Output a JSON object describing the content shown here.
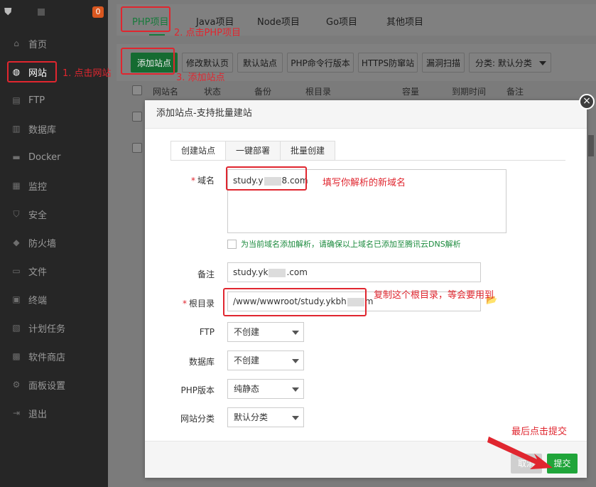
{
  "sidebar": {
    "badge": "0",
    "items": [
      {
        "label": "首页",
        "icon": "home-icon"
      },
      {
        "label": "网站",
        "icon": "globe-icon"
      },
      {
        "label": "FTP",
        "icon": "ftp-icon"
      },
      {
        "label": "数据库",
        "icon": "database-icon"
      },
      {
        "label": "Docker",
        "icon": "docker-icon"
      },
      {
        "label": "监控",
        "icon": "monitor-icon"
      },
      {
        "label": "安全",
        "icon": "shield-icon"
      },
      {
        "label": "防火墙",
        "icon": "firewall-icon"
      },
      {
        "label": "文件",
        "icon": "folder-icon"
      },
      {
        "label": "终端",
        "icon": "terminal-icon"
      },
      {
        "label": "计划任务",
        "icon": "calendar-icon"
      },
      {
        "label": "软件商店",
        "icon": "apps-icon"
      },
      {
        "label": "面板设置",
        "icon": "gear-icon"
      },
      {
        "label": "退出",
        "icon": "logout-icon"
      }
    ]
  },
  "tabs": [
    "PHP项目",
    "Java项目",
    "Node项目",
    "Go项目",
    "其他项目"
  ],
  "toolbar": {
    "add_site": "添加站点",
    "modify_default": "修改默认页",
    "default_site": "默认站点",
    "php_cli": "PHP命令行版本",
    "https_guard": "HTTPS防窜站",
    "vuln_scan": "漏洞扫描",
    "category": "分类: 默认分类"
  },
  "table_header": {
    "name": "网站名",
    "status": "状态",
    "backup": "备份",
    "root": "根目录",
    "capacity": "容量",
    "expire": "到期时间",
    "note": "备注"
  },
  "dialog": {
    "title": "添加站点-支持批量建站",
    "close": "×",
    "tabs": [
      "创建站点",
      "一键部署",
      "批量创建"
    ],
    "domain_label": "域名",
    "domain_value_a": "study.y",
    "domain_value_b": "8.com",
    "dns_checkbox": "为当前域名添加解析，请确保以上域名已添加至腾讯云DNS解析",
    "note_label": "备注",
    "note_value_a": "study.yk",
    "note_value_b": ".com",
    "root_label": "根目录",
    "root_value_a": "/www/wwwroot/study.ykbh",
    "root_value_b": "m",
    "ftp_label": "FTP",
    "ftp_value": "不创建",
    "db_label": "数据库",
    "db_value": "不创建",
    "php_label": "PHP版本",
    "php_value": "纯静态",
    "category_label": "网站分类",
    "category_value": "默认分类",
    "cancel": "取消",
    "submit": "提交"
  },
  "annotations": {
    "step1": "1. 点击网站",
    "step2": "2. 点击PHP项目",
    "step3": "3. 添加站点",
    "domain_tip": "填写你解析的新域名",
    "root_tip": "复制这个根目录，等会要用到",
    "final_tip": "最后点击提交"
  },
  "colors": {
    "accent_green": "#20a53a",
    "annotation_red": "#e0262f",
    "sidebar_bg": "#262626"
  }
}
